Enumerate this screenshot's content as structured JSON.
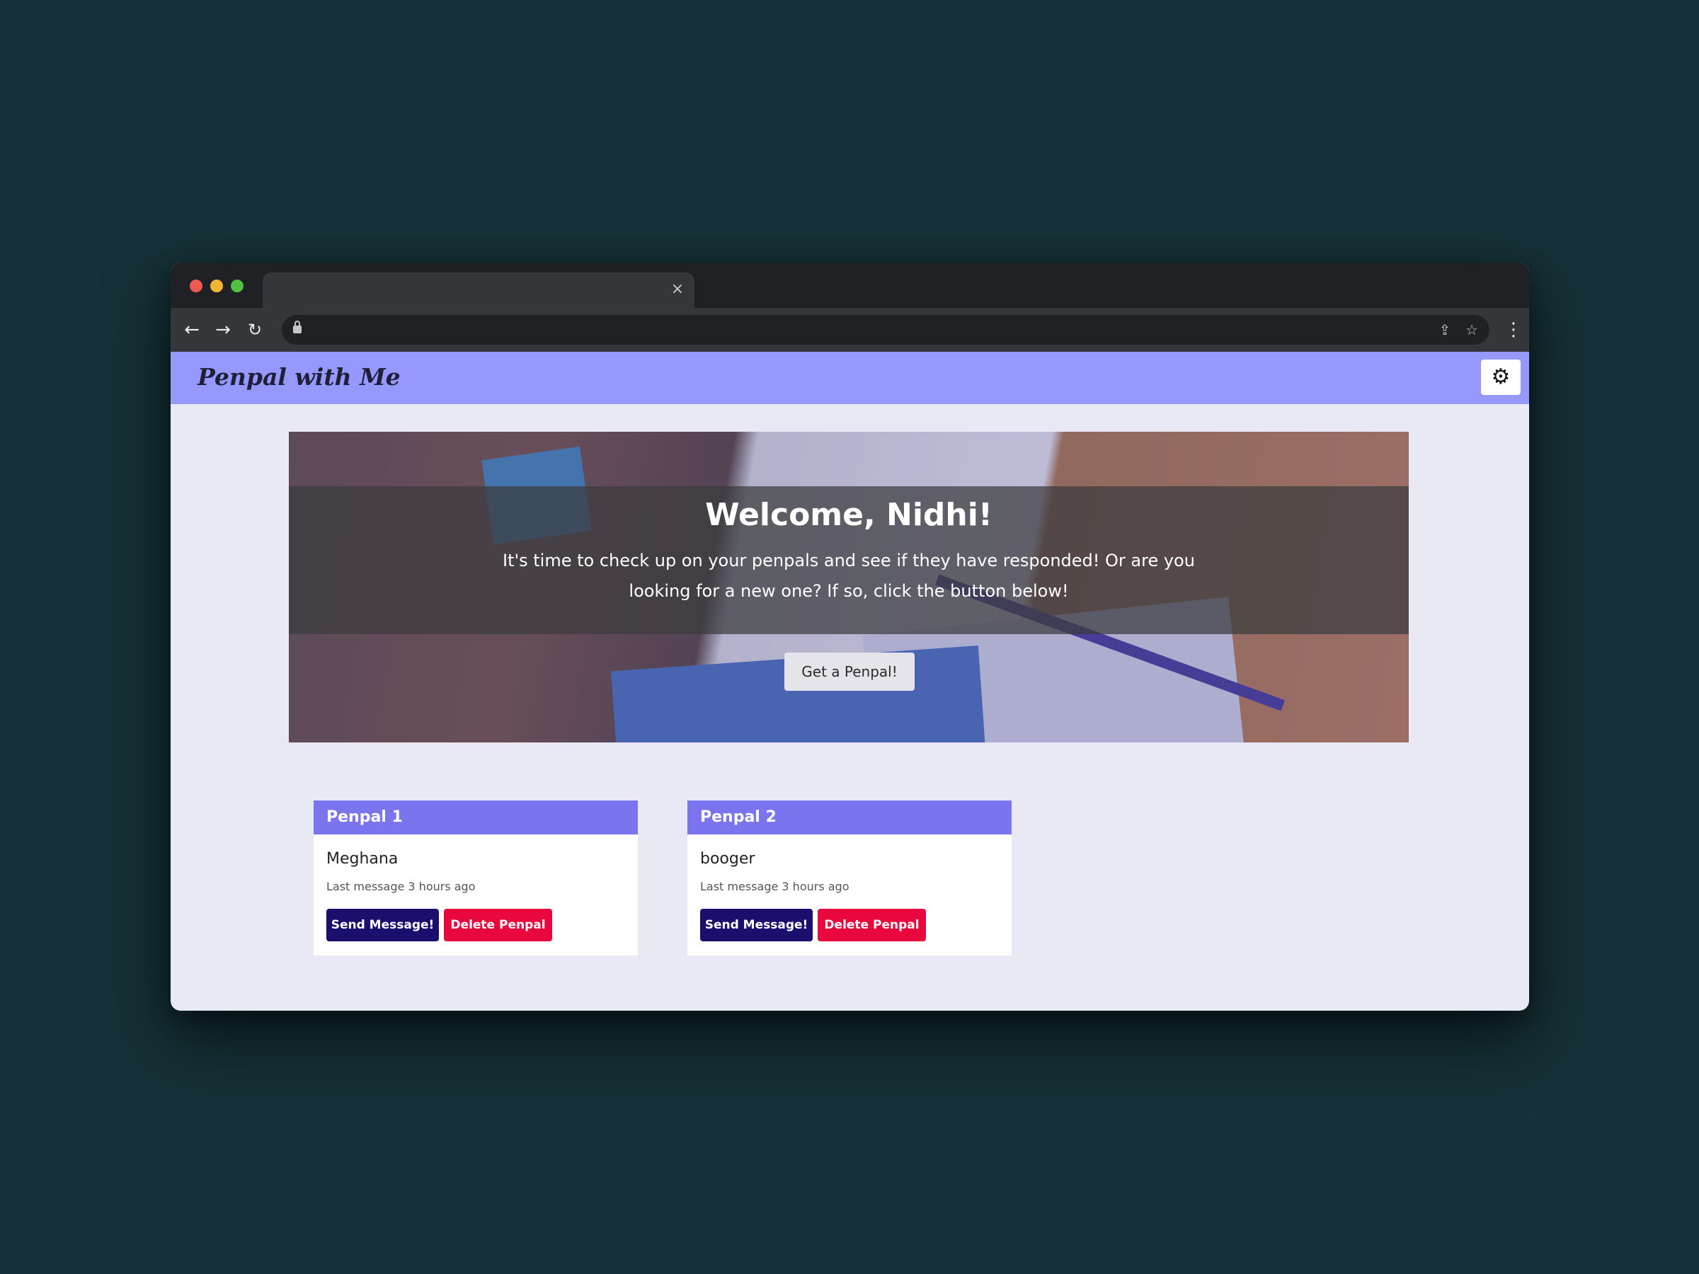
{
  "browser": {
    "tab_close": "×",
    "icons": {
      "back": "arrow-left-icon",
      "forward": "arrow-right-icon",
      "reload": "reload-icon",
      "lock": "lock-icon",
      "share": "share-icon",
      "bookmark": "star-icon",
      "menu": "kebab-menu-icon"
    }
  },
  "app": {
    "brand": "Penpal with Me",
    "settings_icon": "gear-icon",
    "colors": {
      "navbar": "#9698fb",
      "card_header": "#7a74ef",
      "send_button": "#1b0f6e",
      "delete_button": "#e8083d",
      "page_background": "#e8e9f5"
    }
  },
  "hero": {
    "title": "Welcome, Nidhi!",
    "text": "It's time to check up on your penpals and see if they have responded! Or are you looking for a new one? If so, click the button below!",
    "button": "Get a Penpal!"
  },
  "penpals": [
    {
      "header": "Penpal 1",
      "name": "Meghana",
      "last_message": "Last message 3 hours ago",
      "send_label": "Send Message!",
      "delete_label": "Delete Penpal"
    },
    {
      "header": "Penpal 2",
      "name": "booger",
      "last_message": "Last message 3 hours ago",
      "send_label": "Send Message!",
      "delete_label": "Delete Penpal"
    }
  ]
}
